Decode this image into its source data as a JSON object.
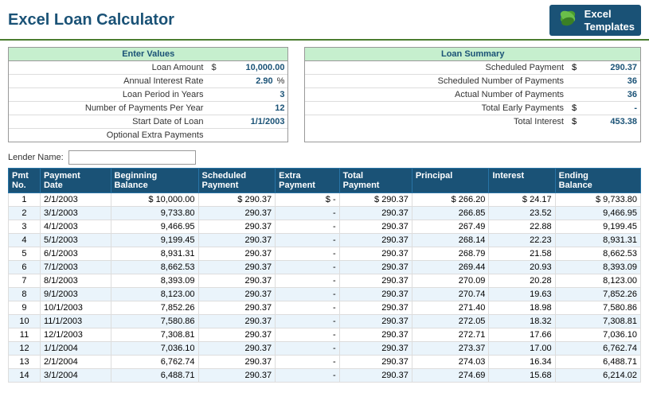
{
  "header": {
    "title": "Excel Loan Calculator",
    "logo_line1": "Excel",
    "logo_line2": "Templates"
  },
  "enter_values": {
    "header": "Enter Values",
    "fields": [
      {
        "label": "Loan Amount",
        "prefix": "$",
        "value": "10,000.00",
        "suffix": ""
      },
      {
        "label": "Annual Interest Rate",
        "prefix": "",
        "value": "2.90",
        "suffix": "%"
      },
      {
        "label": "Loan Period in Years",
        "prefix": "",
        "value": "3",
        "suffix": ""
      },
      {
        "label": "Number of Payments Per Year",
        "prefix": "",
        "value": "12",
        "suffix": ""
      },
      {
        "label": "Start Date of Loan",
        "prefix": "",
        "value": "1/1/2003",
        "suffix": ""
      },
      {
        "label": "Optional Extra Payments",
        "prefix": "",
        "value": "",
        "suffix": ""
      }
    ]
  },
  "loan_summary": {
    "header": "Loan Summary",
    "fields": [
      {
        "label": "Scheduled Payment",
        "prefix": "$",
        "value": "290.37"
      },
      {
        "label": "Scheduled Number of Payments",
        "prefix": "",
        "value": "36"
      },
      {
        "label": "Actual Number of Payments",
        "prefix": "",
        "value": "36"
      },
      {
        "label": "Total Early Payments",
        "prefix": "$",
        "value": "-"
      },
      {
        "label": "Total Interest",
        "prefix": "$",
        "value": "453.38"
      }
    ]
  },
  "lender": {
    "label": "Lender Name:",
    "value": ""
  },
  "table": {
    "columns": [
      {
        "id": "pmt_no",
        "label": "Pmt\nNo."
      },
      {
        "id": "payment_date",
        "label": "Payment\nDate"
      },
      {
        "id": "beg_balance",
        "label": "Beginning\nBalance"
      },
      {
        "id": "scheduled",
        "label": "Scheduled\nPayment"
      },
      {
        "id": "extra",
        "label": "Extra\nPayment"
      },
      {
        "id": "total",
        "label": "Total\nPayment"
      },
      {
        "id": "principal",
        "label": "Principal"
      },
      {
        "id": "interest",
        "label": "Interest"
      },
      {
        "id": "ending",
        "label": "Ending\nBalance"
      }
    ],
    "rows": [
      {
        "pmt_no": "1",
        "payment_date": "2/1/2003",
        "beg_balance": "$ 10,000.00",
        "scheduled": "$ 290.37",
        "extra": "$ -",
        "total": "$ 290.37",
        "principal": "$ 266.20",
        "interest": "$ 24.17",
        "ending": "$ 9,733.80"
      },
      {
        "pmt_no": "2",
        "payment_date": "3/1/2003",
        "beg_balance": "9,733.80",
        "scheduled": "290.37",
        "extra": "-",
        "total": "290.37",
        "principal": "266.85",
        "interest": "23.52",
        "ending": "9,466.95"
      },
      {
        "pmt_no": "3",
        "payment_date": "4/1/2003",
        "beg_balance": "9,466.95",
        "scheduled": "290.37",
        "extra": "-",
        "total": "290.37",
        "principal": "267.49",
        "interest": "22.88",
        "ending": "9,199.45"
      },
      {
        "pmt_no": "4",
        "payment_date": "5/1/2003",
        "beg_balance": "9,199.45",
        "scheduled": "290.37",
        "extra": "-",
        "total": "290.37",
        "principal": "268.14",
        "interest": "22.23",
        "ending": "8,931.31"
      },
      {
        "pmt_no": "5",
        "payment_date": "6/1/2003",
        "beg_balance": "8,931.31",
        "scheduled": "290.37",
        "extra": "-",
        "total": "290.37",
        "principal": "268.79",
        "interest": "21.58",
        "ending": "8,662.53"
      },
      {
        "pmt_no": "6",
        "payment_date": "7/1/2003",
        "beg_balance": "8,662.53",
        "scheduled": "290.37",
        "extra": "-",
        "total": "290.37",
        "principal": "269.44",
        "interest": "20.93",
        "ending": "8,393.09"
      },
      {
        "pmt_no": "7",
        "payment_date": "8/1/2003",
        "beg_balance": "8,393.09",
        "scheduled": "290.37",
        "extra": "-",
        "total": "290.37",
        "principal": "270.09",
        "interest": "20.28",
        "ending": "8,123.00"
      },
      {
        "pmt_no": "8",
        "payment_date": "9/1/2003",
        "beg_balance": "8,123.00",
        "scheduled": "290.37",
        "extra": "-",
        "total": "290.37",
        "principal": "270.74",
        "interest": "19.63",
        "ending": "7,852.26"
      },
      {
        "pmt_no": "9",
        "payment_date": "10/1/2003",
        "beg_balance": "7,852.26",
        "scheduled": "290.37",
        "extra": "-",
        "total": "290.37",
        "principal": "271.40",
        "interest": "18.98",
        "ending": "7,580.86"
      },
      {
        "pmt_no": "10",
        "payment_date": "11/1/2003",
        "beg_balance": "7,580.86",
        "scheduled": "290.37",
        "extra": "-",
        "total": "290.37",
        "principal": "272.05",
        "interest": "18.32",
        "ending": "7,308.81"
      },
      {
        "pmt_no": "11",
        "payment_date": "12/1/2003",
        "beg_balance": "7,308.81",
        "scheduled": "290.37",
        "extra": "-",
        "total": "290.37",
        "principal": "272.71",
        "interest": "17.66",
        "ending": "7,036.10"
      },
      {
        "pmt_no": "12",
        "payment_date": "1/1/2004",
        "beg_balance": "7,036.10",
        "scheduled": "290.37",
        "extra": "-",
        "total": "290.37",
        "principal": "273.37",
        "interest": "17.00",
        "ending": "6,762.74"
      },
      {
        "pmt_no": "13",
        "payment_date": "2/1/2004",
        "beg_balance": "6,762.74",
        "scheduled": "290.37",
        "extra": "-",
        "total": "290.37",
        "principal": "274.03",
        "interest": "16.34",
        "ending": "6,488.71"
      },
      {
        "pmt_no": "14",
        "payment_date": "3/1/2004",
        "beg_balance": "6,488.71",
        "scheduled": "290.37",
        "extra": "-",
        "total": "290.37",
        "principal": "274.69",
        "interest": "15.68",
        "ending": "6,214.02"
      }
    ]
  }
}
